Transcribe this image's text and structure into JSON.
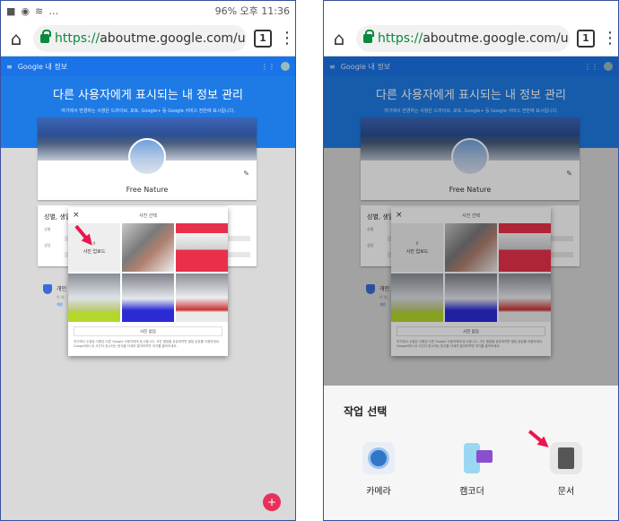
{
  "status": {
    "left_icons": [
      "video-icon",
      "badge-icon",
      "wave-icon",
      "dots-icon"
    ],
    "right_text": "96% 오후 11:36"
  },
  "browser": {
    "url_scheme": "https://",
    "url_rest": "aboutme.google.com/u",
    "tab_count": "1"
  },
  "app": {
    "header_title": "Google 내 정보",
    "hero_title": "다른 사용자에게 표시되는 내 정보 관리",
    "hero_sub": "여기에서 변경하는 사항은 드라이브, 포토, Google+ 등 Google 서비스 전반에 표시됩니다."
  },
  "profile": {
    "name": "Free Nature"
  },
  "section": {
    "title_partial": "성별, 생일",
    "row1": "성별",
    "row2": "생일"
  },
  "privacy": {
    "label_partial": "개인",
    "sub_partial": "이 위",
    "link_partial": "개인"
  },
  "dialog": {
    "title": "사진 선택",
    "upload_label": "사진 업로드",
    "button_label": "사진 없음",
    "note": "여기에서 수정된 사항은 다른 Google 사용자에게 표시됩니다. 사진 앨범을 공유하려면 앨범 공유를 이용하세요. Google에서 내 사진이 표시되는 방식을 자세히 알아보려면 여기를 클릭하세요."
  },
  "sheet": {
    "title": "작업 선택",
    "options": [
      {
        "label": "카메라"
      },
      {
        "label": "캠코더"
      },
      {
        "label": "문서"
      }
    ]
  },
  "colors": {
    "accent": "#1a73e8",
    "fab": "#e8315a",
    "arrow": "#e8174e"
  }
}
